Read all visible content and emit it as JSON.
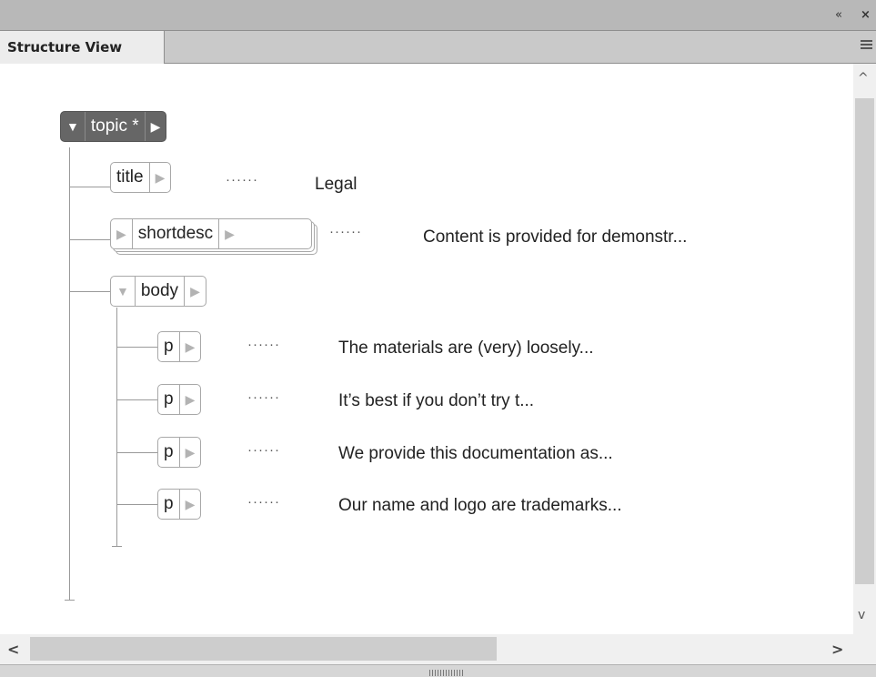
{
  "window": {
    "collapse_icon": "«",
    "close_icon": "×"
  },
  "tab": {
    "label": "Structure View"
  },
  "tree": {
    "root": {
      "label": "topic *",
      "expand": "▼",
      "arrow": "▶"
    },
    "title": {
      "label": "title",
      "arrow": "▶",
      "text": "Legal"
    },
    "shortdesc": {
      "label": "shortdesc",
      "expand": "▶",
      "arrow": "▶",
      "text": "Content is provided for demonstr..."
    },
    "body": {
      "label": "body",
      "expand": "▼",
      "arrow": "▶"
    },
    "paragraphs": [
      {
        "label": "p",
        "arrow": "▶",
        "text": "The materials are (very) loosely..."
      },
      {
        "label": "p",
        "arrow": "▶",
        "text": "It’s best if you don’t try t..."
      },
      {
        "label": "p",
        "arrow": "▶",
        "text": "We provide this documentation as..."
      },
      {
        "label": "p",
        "arrow": "▶",
        "text": "Our name and logo are trademarks..."
      }
    ],
    "dots": "······"
  },
  "scroll": {
    "up": "^",
    "down": "v",
    "left": "<",
    "right": ">"
  }
}
